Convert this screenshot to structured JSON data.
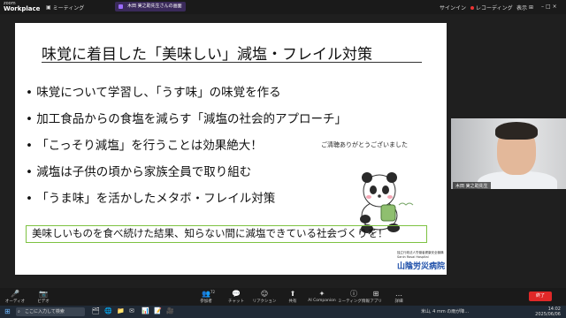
{
  "topbar": {
    "brand_line1": "zoom",
    "brand_line2": "Workplace",
    "meeting_label": "ミーティング",
    "share_chip": "木田 実之助先生さんの画面",
    "signin": "サインイン",
    "recording": "レコーディング",
    "display": "表示"
  },
  "slide": {
    "title": "味覚に着目した「美味しい」減塩・フレイル対策",
    "bullets": [
      "• 味覚について学習し、「うす味」の味覚を作る",
      "• 加工食品からの食塩を減らす「減塩の社会的アプローチ」",
      "• 「こっそり減塩」を行うことは効果絶大！",
      "• 減塩は子供の頃から家族全員で取り組む",
      "• 「うま味」を活かしたメタボ・フレイル対策"
    ],
    "thanks": "ご清聴ありがとうございました",
    "footer": "美味しいものを食べ続けた結果、知らない間に減塩できている社会づくりを！",
    "hospital_small": "独立行政法人労働者健康安全機構\nSanin Rosai Hospital",
    "hospital": "山陰労災病院"
  },
  "video": {
    "name_tag": "木田 実之助先生"
  },
  "toolbar": {
    "items": [
      {
        "icon": "🎤",
        "label": "オーディオ"
      },
      {
        "icon": "📷",
        "label": "ビデオ"
      },
      {
        "icon": "👥",
        "label": "参加者"
      },
      {
        "icon": "💬",
        "label": "チャット"
      },
      {
        "icon": "☺",
        "label": "リアクション"
      },
      {
        "icon": "⬆",
        "label": "共有"
      },
      {
        "icon": "✦",
        "label": "AI Companion"
      },
      {
        "icon": "ⓘ",
        "label": "ミーティング情報"
      },
      {
        "icon": "⊞",
        "label": "アプリ"
      },
      {
        "icon": "…",
        "label": "詳細"
      }
    ],
    "participants_count": "72",
    "end_label": "終了"
  },
  "taskbar": {
    "search_placeholder": "ここに入力して検索",
    "news": "米山, 4 mm の雨が降…",
    "time": "14:02",
    "date": "2025/06/06"
  },
  "colors": {
    "accent_green": "#7dc242",
    "end_red": "#e02828",
    "hospital_blue": "#1a4ca8"
  }
}
